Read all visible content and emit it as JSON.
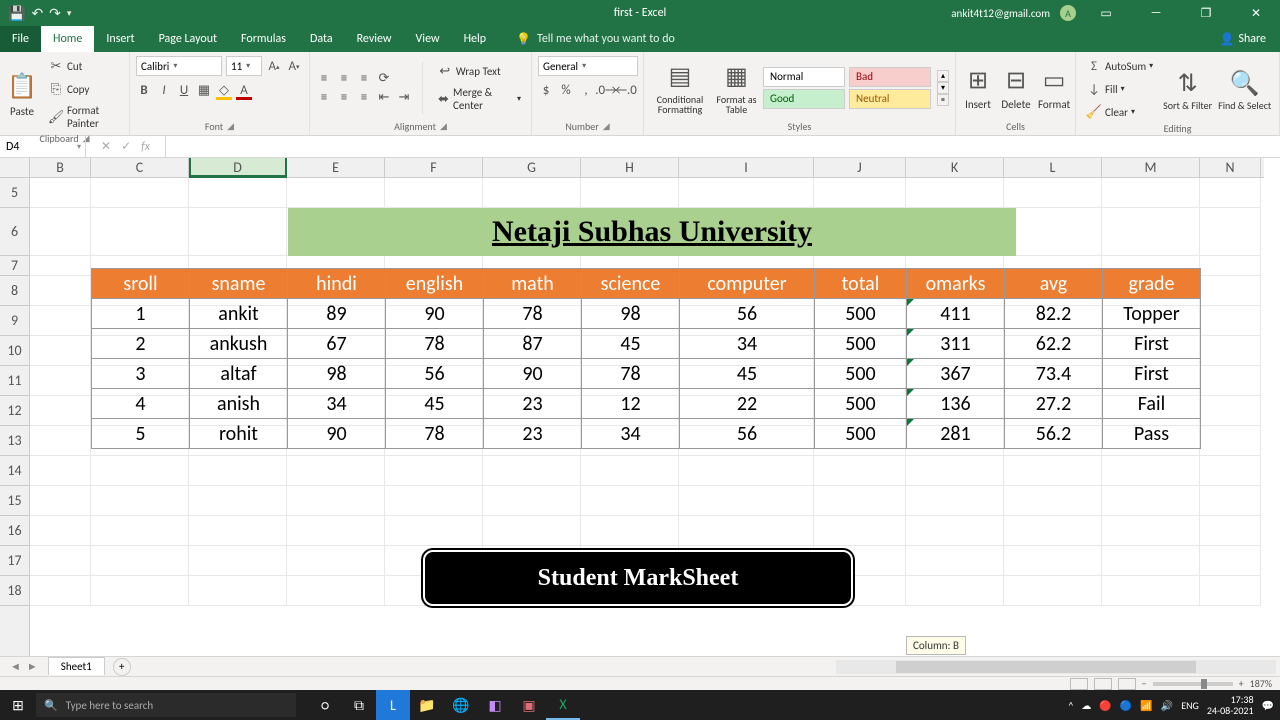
{
  "app": {
    "title": "first  -  Excel",
    "user": "ankit4t12@gmail.com",
    "user_initial": "A"
  },
  "menu": {
    "file": "File",
    "home": "Home",
    "insert": "Insert",
    "page_layout": "Page Layout",
    "formulas": "Formulas",
    "data": "Data",
    "review": "Review",
    "view": "View",
    "help": "Help",
    "tell_me": "Tell me what you want to do",
    "share": "Share"
  },
  "ribbon": {
    "clipboard": {
      "label": "Clipboard",
      "paste": "Paste",
      "cut": "Cut",
      "copy": "Copy",
      "format_painter": "Format Painter"
    },
    "font": {
      "label": "Font",
      "name": "Calibri",
      "size": "11"
    },
    "alignment": {
      "label": "Alignment",
      "wrap": "Wrap Text",
      "merge": "Merge & Center"
    },
    "number": {
      "label": "Number",
      "format": "General"
    },
    "styles": {
      "label": "Styles",
      "cond": "Conditional Formatting",
      "table": "Format as Table",
      "normal": "Normal",
      "bad": "Bad",
      "good": "Good",
      "neutral": "Neutral"
    },
    "cells": {
      "label": "Cells",
      "insert": "Insert",
      "delete": "Delete",
      "format": "Format"
    },
    "editing": {
      "label": "Editing",
      "autosum": "AutoSum",
      "fill": "Fill",
      "clear": "Clear",
      "sort": "Sort & Filter",
      "find": "Find & Select"
    }
  },
  "fxbar": {
    "cell_ref": "D4",
    "formula": ""
  },
  "spreadsheet": {
    "columns": [
      "B",
      "C",
      "D",
      "E",
      "F",
      "G",
      "H",
      "I",
      "J",
      "K",
      "L",
      "M",
      "N"
    ],
    "rows": [
      "5",
      "6",
      "7",
      "8",
      "9",
      "10",
      "11",
      "12",
      "13",
      "14",
      "15",
      "16",
      "17",
      "18"
    ],
    "selected_column_index": 2,
    "title": "Netaji Subhas University",
    "subtitle": "Student MarkSheet",
    "headers": [
      "sroll",
      "sname",
      "hindi",
      "english",
      "math",
      "science",
      "computer",
      "total",
      "omarks",
      "avg",
      "grade"
    ],
    "data": [
      [
        "1",
        "ankit",
        "89",
        "90",
        "78",
        "98",
        "56",
        "500",
        "411",
        "82.2",
        "Topper"
      ],
      [
        "2",
        "ankush",
        "67",
        "78",
        "87",
        "45",
        "34",
        "500",
        "311",
        "62.2",
        "First"
      ],
      [
        "3",
        "altaf",
        "98",
        "56",
        "90",
        "78",
        "45",
        "500",
        "367",
        "73.4",
        "First"
      ],
      [
        "4",
        "anish",
        "34",
        "45",
        "23",
        "12",
        "22",
        "500",
        "136",
        "27.2",
        "Fail"
      ],
      [
        "5",
        "rohit",
        "90",
        "78",
        "23",
        "34",
        "56",
        "500",
        "281",
        "56.2",
        "Pass"
      ]
    ],
    "tooltip": "Column: B"
  },
  "sheet": {
    "tab1": "Sheet1"
  },
  "status": {
    "zoom": "187%"
  },
  "taskbar": {
    "search_placeholder": "Type here to search",
    "lang": "ENG",
    "time": "17:38",
    "date": "24-08-2021"
  }
}
